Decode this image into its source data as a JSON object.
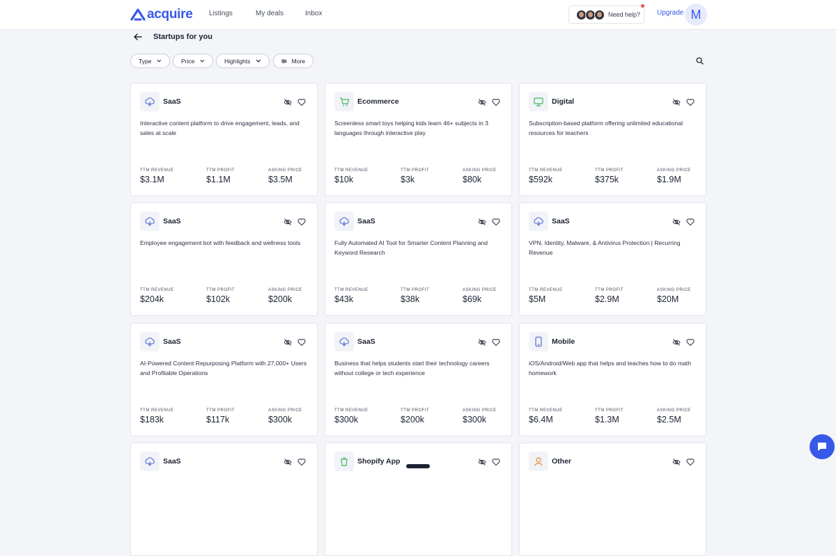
{
  "header": {
    "logo_text": "acquire",
    "nav": [
      "Listings",
      "My deals",
      "Inbox"
    ],
    "help_text": "Need help?",
    "upgrade_label": "Upgrade",
    "user_initial": "M"
  },
  "page": {
    "title": "Startups for you"
  },
  "filters": {
    "type": "Type",
    "price": "Price",
    "highlights": "Highlights",
    "more": "More"
  },
  "metric_labels": {
    "revenue": "TTM revenue",
    "profit": "TTM profit",
    "asking": "Asking price"
  },
  "cards": [
    {
      "type": "SaaS",
      "icon": "saas-icon",
      "desc": "Interactive content platform to drive engagement, leads, and sales at scale",
      "revenue": "$3.1M",
      "profit": "$1.1M",
      "asking": "$3.5M"
    },
    {
      "type": "Ecommerce",
      "icon": "ecommerce-icon",
      "desc": "Screenless smart toys helping kids learn 46+ subjects in 3 languages through interactive play",
      "revenue": "$10k",
      "profit": "$3k",
      "asking": "$80k"
    },
    {
      "type": "Digital",
      "icon": "digital-icon",
      "desc": "Subscription-based platform offering unlimited educational resources for teachers",
      "revenue": "$592k",
      "profit": "$375k",
      "asking": "$1.9M"
    },
    {
      "type": "SaaS",
      "icon": "saas-icon",
      "desc": "Employee engagement bot with feedback and wellness tools",
      "revenue": "$204k",
      "profit": "$102k",
      "asking": "$200k"
    },
    {
      "type": "SaaS",
      "icon": "saas-icon",
      "desc": "Fully Automated AI Tool for Smarter Content Planning and Keyword Research",
      "revenue": "$43k",
      "profit": "$38k",
      "asking": "$69k"
    },
    {
      "type": "SaaS",
      "icon": "saas-icon",
      "desc": "VPN, Identity, Malware, & Antivirus Protection | Recurring Revenue",
      "revenue": "$5M",
      "profit": "$2.9M",
      "asking": "$20M"
    },
    {
      "type": "SaaS",
      "icon": "saas-icon",
      "desc": "AI-Powered Content Repurposing Platform with 27,000+ Users and Profitable Operations",
      "revenue": "$183k",
      "profit": "$117k",
      "asking": "$300k"
    },
    {
      "type": "SaaS",
      "icon": "saas-icon",
      "desc": "Business that helps students start their technology careers without college or tech experience",
      "revenue": "$300k",
      "profit": "$200k",
      "asking": "$300k"
    },
    {
      "type": "Mobile",
      "icon": "mobile-icon",
      "desc": "iOS/Android/Web app that helps and teaches how to do math homework",
      "revenue": "$6.4M",
      "profit": "$1.3M",
      "asking": "$2.5M"
    },
    {
      "type": "SaaS",
      "icon": "saas-icon",
      "desc": "",
      "revenue": "",
      "profit": "",
      "asking": ""
    },
    {
      "type": "Shopify App",
      "icon": "shopify-icon",
      "desc": "",
      "revenue": "",
      "profit": "",
      "asking": ""
    },
    {
      "type": "Other",
      "icon": "other-icon",
      "desc": "",
      "revenue": "",
      "profit": "",
      "asking": ""
    }
  ],
  "colors": {
    "accent": "#3659e8",
    "background": "#f4f5f8",
    "saas_icon": "#6b7fd8",
    "ecommerce_icon": "#5cbf73",
    "digital_icon": "#5cbf73",
    "mobile_icon": "#6b7fd8",
    "other_icon": "#e89a4b"
  }
}
